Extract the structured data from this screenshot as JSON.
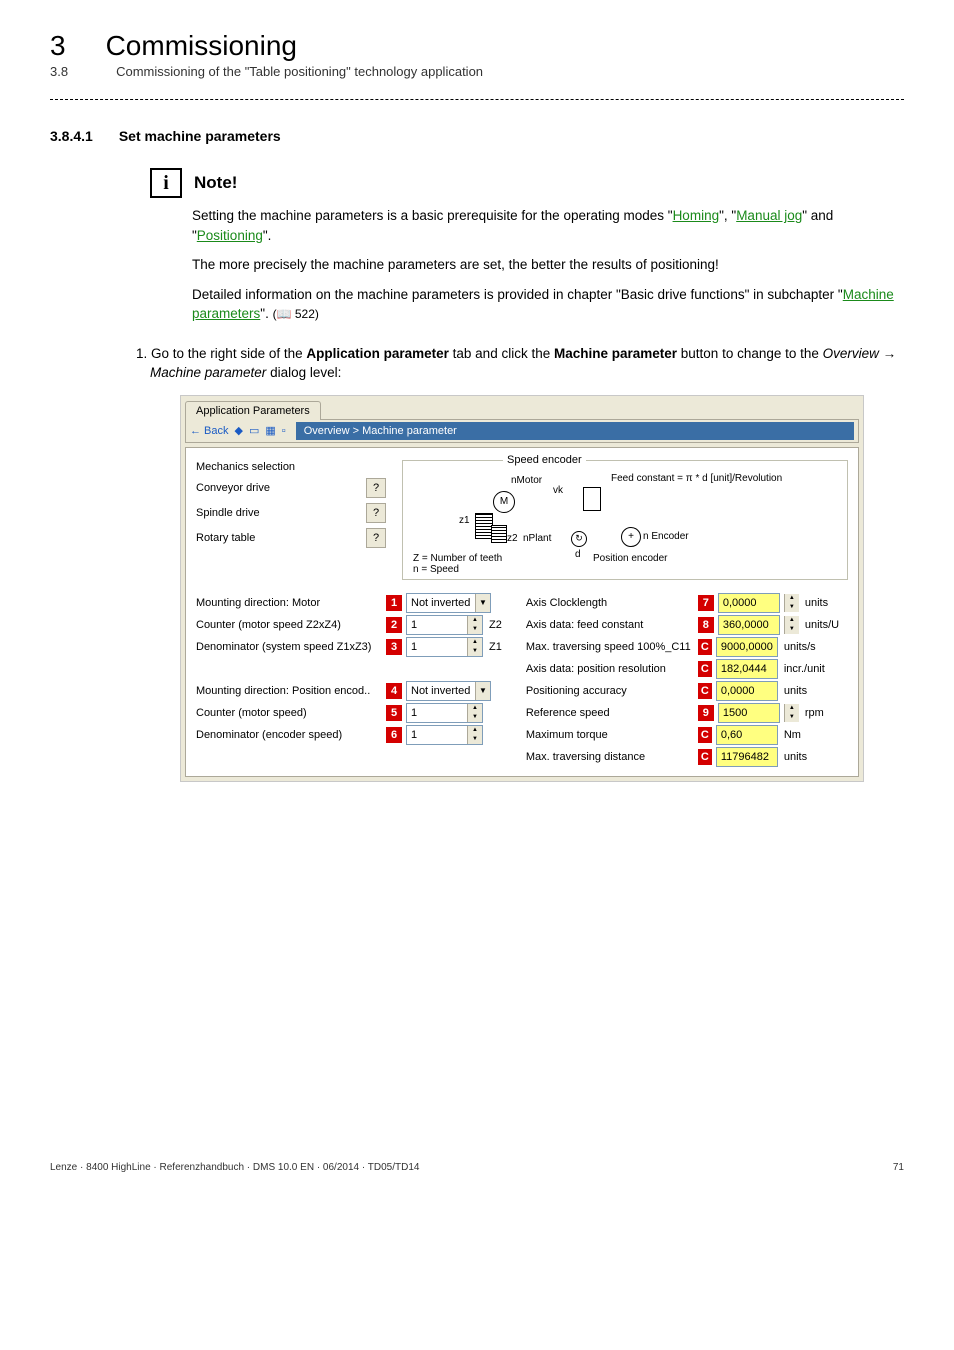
{
  "header": {
    "chapNum": "3",
    "chapTitle": "Commissioning",
    "subNum": "3.8",
    "subTitle": "Commissioning of the \"Table positioning\" technology application"
  },
  "section": {
    "num": "3.8.4.1",
    "title": "Set machine parameters"
  },
  "note": {
    "icon": "i",
    "title": "Note!",
    "p1a": "Setting the machine parameters is a basic prerequisite for the operating modes \"",
    "l1": "Homing",
    "p1b": "\", \"",
    "l2": "Manual jog",
    "p1c": "\" and \"",
    "l3": "Positioning",
    "p1d": "\".",
    "p2": "The more precisely the machine parameters are set, the better the results of positioning!",
    "p3a": "Detailed information on the machine parameters is provided in chapter \"Basic drive functions\" in subchapter \"",
    "l4": "Machine parameters",
    "p3b": "\". ",
    "pageIcon": "📖",
    "pageRef": "522)"
  },
  "step": {
    "num": "1.",
    "t1": " Go to the right side of the ",
    "b1": "Application parameter",
    "t2": " tab and click the ",
    "b2": "Machine parameter",
    "t3": " button to change to the ",
    "i1": "Overview",
    "arrow": " → ",
    "i2": "Machine parameter",
    "t4": " dialog level:"
  },
  "app": {
    "tab": "Application Parameters",
    "nav": {
      "back": "← Back",
      "path": "Overview > Machine parameter"
    },
    "mech": {
      "title": "Mechanics selection",
      "r1": "Conveyor drive",
      "r2": "Spindle drive",
      "r3": "Rotary table",
      "q": "?"
    },
    "diag": {
      "legend": "Speed encoder",
      "feed": "Feed constant = π * d [unit]/Revolution",
      "nMotor": "nMotor",
      "M": "M",
      "vk": "vk",
      "z1": "z1",
      "z2": "z2",
      "nPlant": "nPlant",
      "nEnc": "n Encoder",
      "d": "d",
      "pos": "Position encoder",
      "zn": "Z = Number of teeth\nn = Speed",
      "plus": "+",
      "sym": "↻"
    },
    "left": [
      {
        "label": "Mounting direction: Motor",
        "m": "1",
        "type": "combo",
        "val": "Not inverted"
      },
      {
        "label": "Counter (motor speed Z2xZ4)",
        "m": "2",
        "type": "num",
        "val": "1",
        "suffix": "Z2"
      },
      {
        "label": "Denominator (system speed Z1xZ3)",
        "m": "3",
        "type": "num",
        "val": "1",
        "suffix": "Z1"
      },
      {
        "label": "",
        "m": "",
        "type": "spacer"
      },
      {
        "label": "Mounting direction: Position encod..",
        "m": "4",
        "type": "combo",
        "val": "Not inverted"
      },
      {
        "label": "Counter (motor speed)",
        "m": "5",
        "type": "num",
        "val": "1"
      },
      {
        "label": "Denominator (encoder speed)",
        "m": "6",
        "type": "num",
        "val": "1"
      }
    ],
    "right": [
      {
        "label": "Axis Clocklength",
        "m": "7",
        "type": "ynum",
        "val": "0,0000",
        "unit": "units",
        "spin": true
      },
      {
        "label": "Axis data: feed constant",
        "m": "8",
        "type": "ynum",
        "val": "360,0000",
        "unit": "units/U",
        "spin": true
      },
      {
        "label": "Max. traversing speed 100%_C11",
        "m": "C",
        "type": "ynum",
        "val": "9000,0000",
        "unit": "units/s"
      },
      {
        "label": "Axis data: position resolution",
        "m": "C",
        "type": "ynum",
        "val": "182,0444",
        "unit": "incr./unit"
      },
      {
        "label": "Positioning accuracy",
        "m": "C",
        "type": "ynum",
        "val": "0,0000",
        "unit": "units"
      },
      {
        "label": "Reference speed",
        "m": "9",
        "type": "ynum",
        "val": "1500",
        "unit": "rpm",
        "spin": true
      },
      {
        "label": "Maximum torque",
        "m": "C",
        "type": "ynum",
        "val": "0,60",
        "unit": "Nm"
      },
      {
        "label": "Max. traversing distance",
        "m": "C",
        "type": "ynum",
        "val": "11796482",
        "unit": "units"
      }
    ]
  },
  "footer": {
    "left": "Lenze · 8400 HighLine · Referenzhandbuch · DMS 10.0 EN · 06/2014 · TD05/TD14",
    "right": "71"
  }
}
